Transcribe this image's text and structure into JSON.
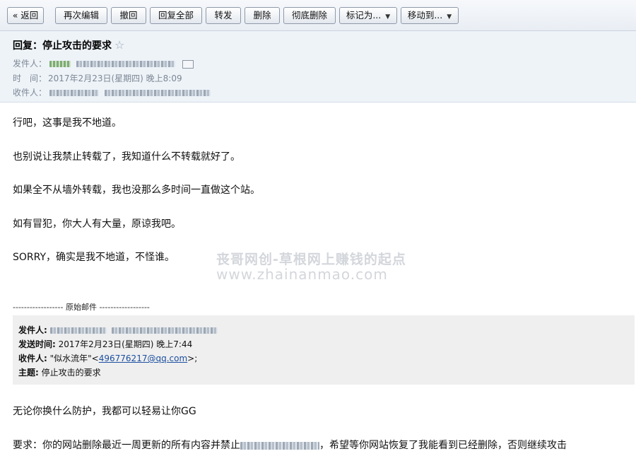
{
  "toolbar": {
    "back": "« 返回",
    "edit_again": "再次编辑",
    "undo": "撤回",
    "reply_all": "回复全部",
    "forward": "转发",
    "delete": "删除",
    "delete_permanently": "彻底删除",
    "mark_as": "标记为...",
    "move_to": "移动到...",
    "caret": "▼"
  },
  "header": {
    "subject": "回复：停止攻击的要求",
    "star": "☆",
    "from_label": "发件人：",
    "time_label": "时　间：",
    "time_value": "2017年2月23日(星期四) 晚上8:09",
    "to_label": "收件人："
  },
  "body": {
    "p1": "行吧，这事是我不地道。",
    "p2": "也别说让我禁止转载了，我知道什么不转载就好了。",
    "p3": "如果全不从墙外转载，我也没那么多时间一直做这个站。",
    "p4": "如有冒犯，你大人有大量，原谅我吧。",
    "p5": "SORRY，确实是我不地道，不怪谁。"
  },
  "watermark": {
    "line1": "丧哥网创-草根网上赚钱的起点",
    "line2": "www.zhainanmao.com"
  },
  "original": {
    "divider": "------------------ 原始邮件 ------------------",
    "from_label": "发件人:",
    "sent_label": "发送时间:",
    "sent_value": "2017年2月23日(星期四) 晚上7:44",
    "to_label": "收件人:",
    "to_name": "\"似水流年\"<",
    "to_email": "496776217@qq.com",
    "to_end": ">;",
    "subject_label": "主题:",
    "subject_value": "停止攻击的要求"
  },
  "original_body": {
    "p1": "无论你换什么防护，我都可以轻易让你GG",
    "p2_start": "要求：你的网站删除最近一周更新的所有内容并禁止",
    "p2_end": "，希望等你网站恢复了我能看到已经删除，否则继续攻击"
  }
}
